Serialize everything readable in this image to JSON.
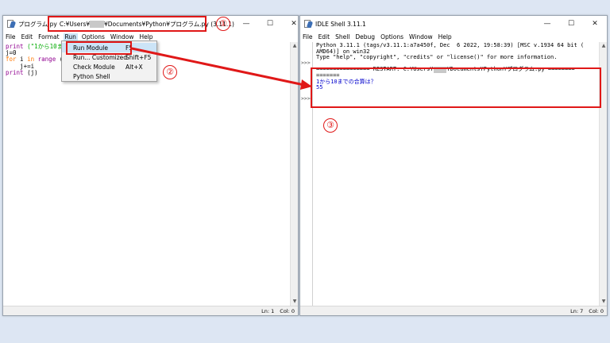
{
  "editor": {
    "title": "プログラム.py",
    "path": "C:¥Users¥",
    "path_rest": "¥Documents¥Python¥プログラム.py (3.11.1)",
    "masked_user": "xxxx",
    "menu": [
      "File",
      "Edit",
      "Format",
      "Run",
      "Options",
      "Window",
      "Help"
    ],
    "code": {
      "l1_kw": "print",
      "l1_str": " (\"1から10まで",
      "l2": "j=0",
      "l3_kw": "for",
      "l3_a": " i ",
      "l3_in": "in",
      "l3_b": " ",
      "l3_bi": "range",
      "l3_c": " (",
      "l4": "    j+=i",
      "l5_bi": "print",
      "l5_rest": " (j)"
    },
    "status": {
      "ln": "Ln: 1",
      "col": "Col: 0"
    }
  },
  "run_menu": {
    "items": [
      {
        "label": "Run Module",
        "shortcut": "F5"
      },
      {
        "label": "Run... Customized",
        "shortcut": "Shift+F5"
      },
      {
        "label": "Check Module",
        "shortcut": "Alt+X"
      },
      {
        "label": "Python Shell",
        "shortcut": ""
      }
    ]
  },
  "shell": {
    "title": "IDLE Shell 3.11.1",
    "menu": [
      "File",
      "Edit",
      "Shell",
      "Debug",
      "Options",
      "Window",
      "Help"
    ],
    "banner1": "Python 3.11.1 (tags/v3.11.1:a7a450f, Dec  6 2022, 19:58:39) [MSC v.1934 64 bit (",
    "banner2": "AMD64)] on win32",
    "banner3": "Type \"help\", \"copyright\", \"credits\" or \"license()\" for more information.",
    "restart1": "================ RESTART: C:¥Users¥",
    "restart_rest": "¥Documents¥Python¥プログラム.py ========",
    "restart2": "=======",
    "out1": "1から10までの合算は？",
    "out2": "55",
    "prompt": ">>>",
    "status": {
      "ln": "Ln: 7",
      "col": "Col: 0"
    }
  },
  "window_controls": {
    "min": "—",
    "max": "☐",
    "close": "✕"
  },
  "annotations": {
    "one": "①",
    "two": "②",
    "three": "③"
  },
  "colors": {
    "annotation": "#e01818",
    "keyword": "#ff7700",
    "builtin": "#900090",
    "string": "#00aa00",
    "output": "#0000cc"
  }
}
